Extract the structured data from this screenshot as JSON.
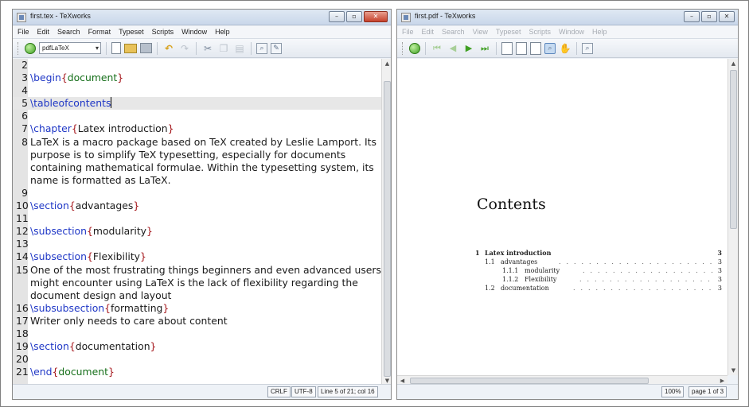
{
  "left_window": {
    "title": "first.tex - TeXworks",
    "menu": [
      "File",
      "Edit",
      "Search",
      "Format",
      "Typeset",
      "Scripts",
      "Window",
      "Help"
    ],
    "engine": "pdfLaTeX",
    "lines": [
      {
        "n": "2",
        "parts": []
      },
      {
        "n": "3",
        "parts": [
          {
            "t": "cmd",
            "v": "\\begin"
          },
          {
            "t": "brace",
            "v": "{"
          },
          {
            "t": "arg",
            "v": "document"
          },
          {
            "t": "brace",
            "v": "}"
          }
        ]
      },
      {
        "n": "4",
        "parts": []
      },
      {
        "n": "5",
        "current": true,
        "parts": [
          {
            "t": "cmd",
            "v": "\\tableofcontents"
          },
          {
            "t": "caret",
            "v": ""
          }
        ]
      },
      {
        "n": "6",
        "parts": []
      },
      {
        "n": "7",
        "parts": [
          {
            "t": "cmd",
            "v": "\\chapter"
          },
          {
            "t": "brace",
            "v": "{"
          },
          {
            "t": "text",
            "v": "Latex introduction"
          },
          {
            "t": "brace",
            "v": "}"
          }
        ]
      },
      {
        "n": "8",
        "parts": [
          {
            "t": "text",
            "v": "LaTeX  is a macro package based on TeX created by Leslie Lamport. Its"
          }
        ]
      },
      {
        "n": "",
        "parts": [
          {
            "t": "text",
            "v": "purpose is to simplify TeX typesetting, especially for documents"
          }
        ]
      },
      {
        "n": "",
        "parts": [
          {
            "t": "text",
            "v": "containing mathematical formulae. Within the typesetting system, its"
          }
        ]
      },
      {
        "n": "",
        "parts": [
          {
            "t": "text",
            "v": "name is formatted as LaTeX."
          }
        ]
      },
      {
        "n": "9",
        "parts": []
      },
      {
        "n": "10",
        "parts": [
          {
            "t": "cmd",
            "v": "\\section"
          },
          {
            "t": "brace",
            "v": "{"
          },
          {
            "t": "text",
            "v": "advantages"
          },
          {
            "t": "brace",
            "v": "}"
          }
        ]
      },
      {
        "n": "11",
        "parts": []
      },
      {
        "n": "12",
        "parts": [
          {
            "t": "cmd",
            "v": "\\subsection"
          },
          {
            "t": "brace",
            "v": "{"
          },
          {
            "t": "text",
            "v": "modularity"
          },
          {
            "t": "brace",
            "v": "}"
          }
        ]
      },
      {
        "n": "13",
        "parts": []
      },
      {
        "n": "14",
        "parts": [
          {
            "t": "cmd",
            "v": "\\subsection"
          },
          {
            "t": "brace",
            "v": "{"
          },
          {
            "t": "text",
            "v": "Flexibility"
          },
          {
            "t": "brace",
            "v": "}"
          }
        ]
      },
      {
        "n": "15",
        "parts": [
          {
            "t": "text",
            "v": "One of the most frustrating things beginners and even advanced users"
          }
        ]
      },
      {
        "n": "",
        "parts": [
          {
            "t": "text",
            "v": "might encounter using LaTeX is the lack of flexibility regarding the"
          }
        ]
      },
      {
        "n": "",
        "parts": [
          {
            "t": "text",
            "v": "document design and layout"
          }
        ]
      },
      {
        "n": "16",
        "parts": [
          {
            "t": "cmd",
            "v": "\\subsubsection"
          },
          {
            "t": "brace",
            "v": "{"
          },
          {
            "t": "text",
            "v": "formatting"
          },
          {
            "t": "brace",
            "v": "}"
          }
        ]
      },
      {
        "n": "17",
        "parts": [
          {
            "t": "text",
            "v": "Writer only needs to care about content"
          }
        ]
      },
      {
        "n": "18",
        "parts": []
      },
      {
        "n": "19",
        "parts": [
          {
            "t": "cmd",
            "v": "\\section"
          },
          {
            "t": "brace",
            "v": "{"
          },
          {
            "t": "text",
            "v": "documentation"
          },
          {
            "t": "brace",
            "v": "}"
          }
        ]
      },
      {
        "n": "20",
        "parts": []
      },
      {
        "n": "21",
        "parts": [
          {
            "t": "cmd",
            "v": "\\end"
          },
          {
            "t": "brace",
            "v": "{"
          },
          {
            "t": "arg",
            "v": "document"
          },
          {
            "t": "brace",
            "v": "}"
          }
        ]
      }
    ],
    "status": {
      "line_ending": "CRLF",
      "encoding": "UTF-8",
      "position": "Line 5 of 21; col 16"
    }
  },
  "right_window": {
    "title": "first.pdf - TeXworks",
    "menu": [
      "File",
      "Edit",
      "Search",
      "View",
      "Typeset",
      "Scripts",
      "Window",
      "Help"
    ],
    "toc_title": "Contents",
    "toc": [
      {
        "level": 0,
        "num": "1",
        "title": "Latex introduction",
        "page": "3"
      },
      {
        "level": 1,
        "num": "1.1",
        "title": "advantages",
        "page": "3"
      },
      {
        "level": 2,
        "num": "1.1.1",
        "title": "modularity",
        "page": "3"
      },
      {
        "level": 2,
        "num": "1.1.2",
        "title": "Flexibility",
        "page": "3"
      },
      {
        "level": 1,
        "num": "1.2",
        "title": "documentation",
        "page": "3"
      }
    ],
    "status": {
      "zoom": "100%",
      "page": "page 1 of 3"
    }
  },
  "window_buttons": {
    "minimize": "–",
    "maximize": "▫",
    "close": "✕"
  },
  "colors": {
    "command": "#1f37c6",
    "brace": "#a5171c",
    "argument": "#166f1a"
  }
}
